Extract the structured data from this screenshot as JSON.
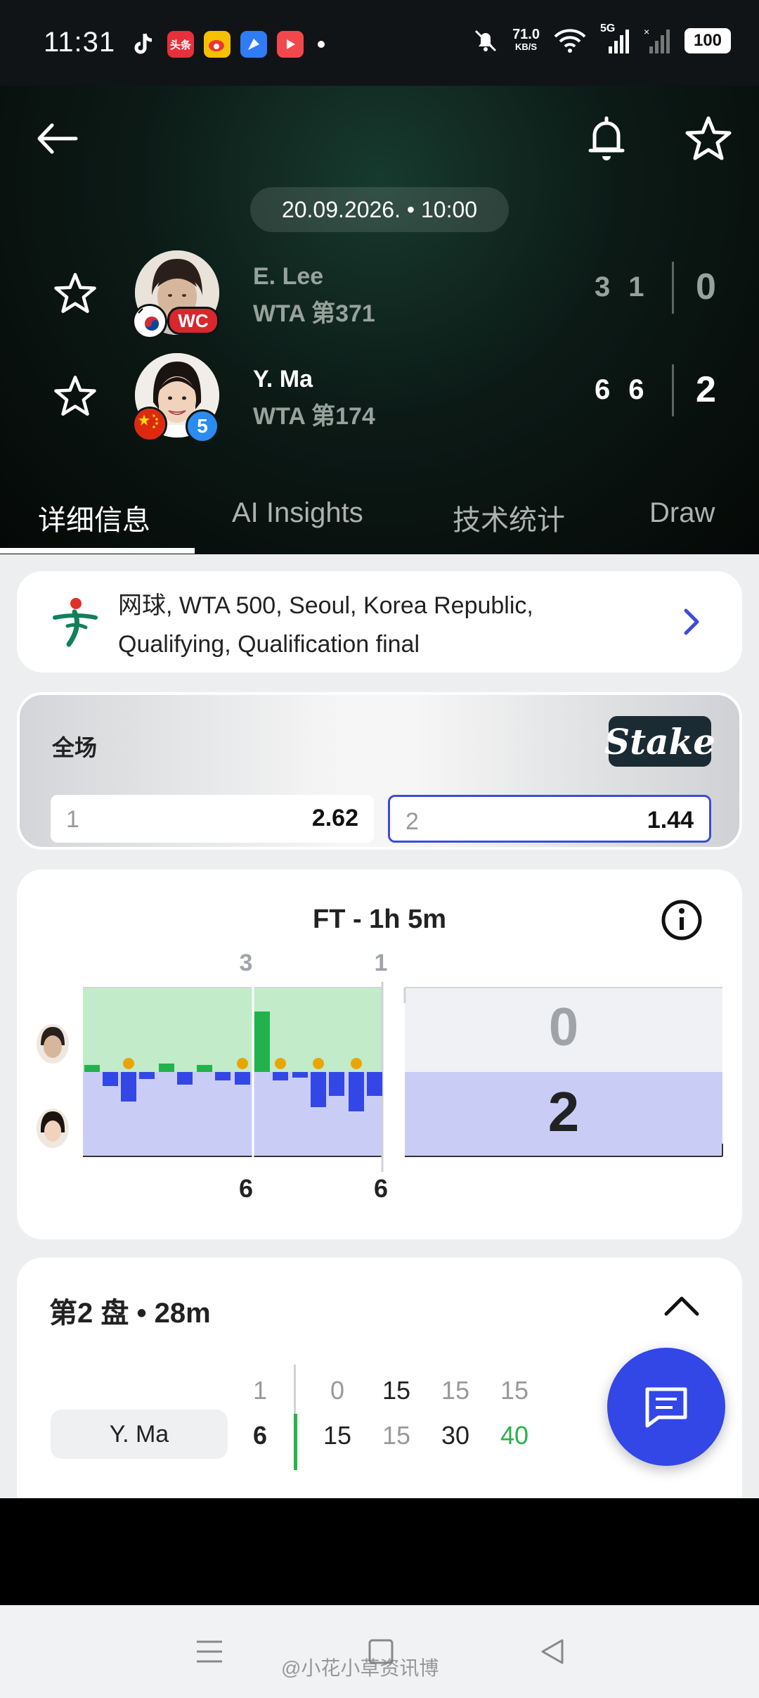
{
  "status_bar": {
    "time": "11:31",
    "net_speed": "71.0",
    "net_speed_unit": "KB/S",
    "network": "5G",
    "battery": "100"
  },
  "match": {
    "date_time": "20.09.2026. • 10:00",
    "player1": {
      "name": "E. Lee",
      "rank": "WTA 第371",
      "badge": "WC",
      "sets": [
        "3",
        "1"
      ],
      "total": "0"
    },
    "player2": {
      "name": "Y. Ma",
      "rank": "WTA 第174",
      "badge": "5",
      "sets": [
        "6",
        "6"
      ],
      "total": "2"
    }
  },
  "tabs": [
    "详细信息",
    "AI Insights",
    "技术统计",
    "Draw"
  ],
  "competition": {
    "text": "网球, WTA 500, Seoul, Korea Republic, Qualifying, Qualification final"
  },
  "odds": {
    "title": "全场",
    "bookmaker": "Stake",
    "options": [
      {
        "label": "1",
        "value": "2.62"
      },
      {
        "label": "2",
        "value": "1.44"
      }
    ]
  },
  "momentum": {
    "title": "FT - 1h 5m",
    "set_top_labels": [
      "3",
      "1"
    ],
    "set_bottom_labels": [
      "6",
      "6"
    ],
    "score_top": "0",
    "score_bottom": "2",
    "colors": {
      "player1": "#22b24c",
      "player2": "#3347e6",
      "break": "#e9a600"
    }
  },
  "set_detail": {
    "title": "第2 盘 • 28m",
    "header_game": "1",
    "header_points": [
      "0",
      "15",
      "15",
      "15"
    ],
    "player": "Y. Ma",
    "player_game": "6",
    "player_points": [
      "15",
      "15",
      "30",
      "40"
    ]
  },
  "watermark": "@小花小草资讯博",
  "icons": [
    "back-arrow-icon",
    "bell-icon",
    "star-icon",
    "chevron-right-icon",
    "info-icon",
    "chevron-up-icon",
    "chat-icon"
  ]
}
